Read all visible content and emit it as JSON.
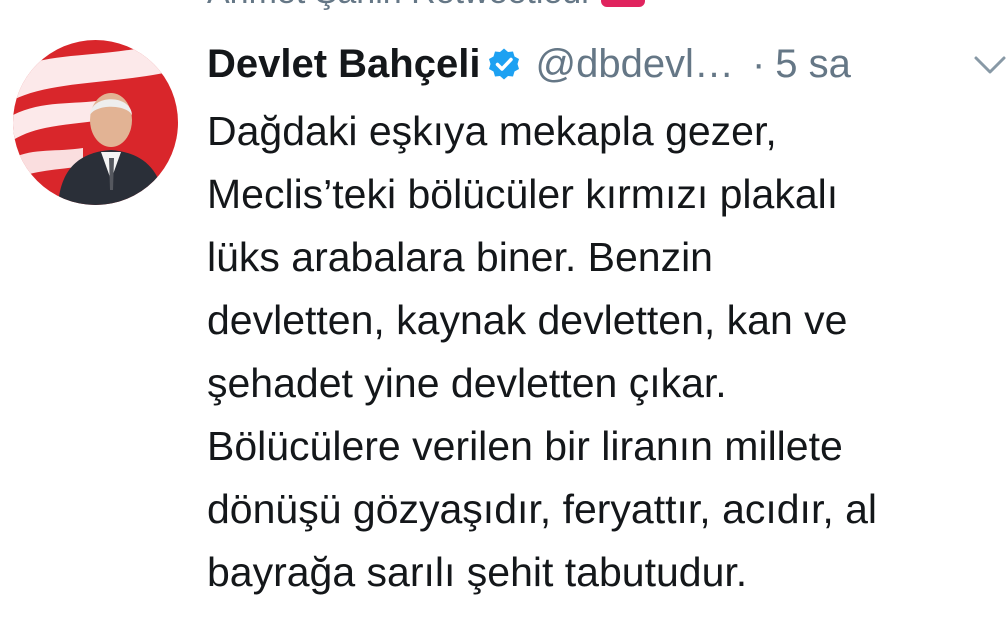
{
  "context": {
    "text": "Ahmet Şahin Retweetledi"
  },
  "author": {
    "name": "Devlet Bahçeli",
    "verified": true,
    "handle": "@dbdevl…",
    "separator": "·",
    "time": "5 sa"
  },
  "tweet": {
    "lines": [
      "Dağdaki eşkıya mekapla gezer,",
      "Meclis’teki bölücüler kırmızı plakalı",
      "lüks arabalara biner. Benzin",
      "devletten, kaynak devletten, kan ve",
      "şehadet yine devletten çıkar.",
      "Bölücülere verilen bir liranın millete",
      "dönüşü gözyaşıdır, feryattır, acıdır, al",
      "bayrağa sarılı şehit tabutudur."
    ]
  },
  "icons": {
    "verified": "verified-badge-icon",
    "menu": "chevron-down-icon",
    "retweet": "retweet-icon"
  },
  "colors": {
    "text": "#14171a",
    "secondary": "#657786",
    "verified": "#1da1f2",
    "retweet_badge": "#e0245e",
    "flag_red": "#d9262b"
  }
}
